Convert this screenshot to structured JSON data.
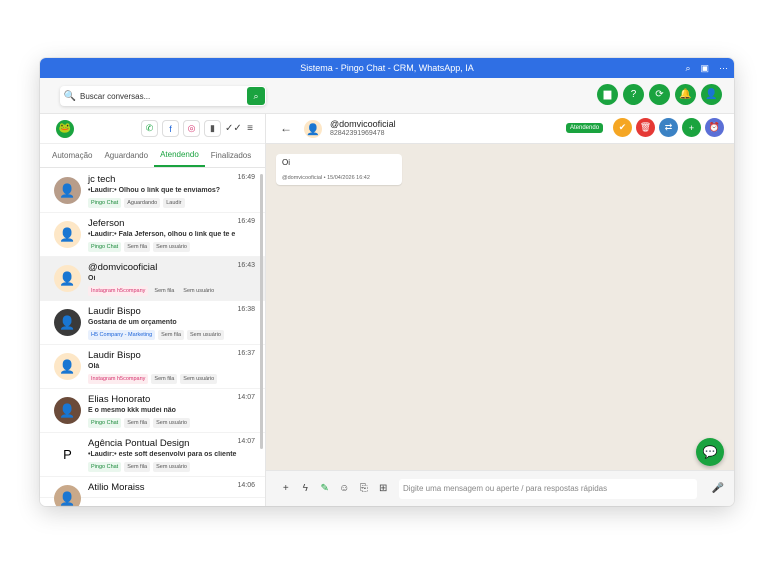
{
  "window": {
    "title": "Sistema - Pingo Chat - CRM, WhatsApp, IA"
  },
  "titlebar_icons": [
    "zoom-icon",
    "cast-icon",
    "more-icon"
  ],
  "search": {
    "placeholder": "Buscar conversas..."
  },
  "top_actions": [
    {
      "name": "chat-icon",
      "glyph": "▆"
    },
    {
      "name": "help-icon",
      "glyph": "?"
    },
    {
      "name": "refresh-icon",
      "glyph": "⟳"
    },
    {
      "name": "bell-icon",
      "glyph": "🔔"
    },
    {
      "name": "user-icon",
      "glyph": "👤"
    }
  ],
  "tabs": [
    {
      "label": "Automação",
      "active": false
    },
    {
      "label": "Aguardando",
      "active": false
    },
    {
      "label": "Atendendo",
      "active": true
    },
    {
      "label": "Finalizados",
      "active": false
    }
  ],
  "conversations": [
    {
      "name": "jc tech",
      "time": "16:49",
      "message": "•Laudir:• Olhou o link que te enviamos?",
      "tags": [
        {
          "text": "Pingo Chat",
          "kind": "wa"
        },
        {
          "text": "Aguardando",
          "kind": ""
        },
        {
          "text": "Laudir",
          "kind": ""
        }
      ],
      "avatar_bg": "#b89d8a",
      "avatar_glyph": "👤"
    },
    {
      "name": "Jeferson",
      "time": "16:49",
      "message": "•Laudir:• Fala Jeferson, olhou o link que te e",
      "tags": [
        {
          "text": "Pingo Chat",
          "kind": "wa"
        },
        {
          "text": "Sem fila",
          "kind": ""
        },
        {
          "text": "Sem usuário",
          "kind": ""
        }
      ],
      "avatar_bg": "#fde7c7",
      "avatar_glyph": "👤"
    },
    {
      "name": "@domvicooficial",
      "time": "16:43",
      "message": "Oi",
      "tags": [
        {
          "text": "Instagram h5company",
          "kind": "ig"
        },
        {
          "text": "Sem fila",
          "kind": ""
        },
        {
          "text": "Sem usuário",
          "kind": ""
        }
      ],
      "avatar_bg": "#fde7c7",
      "avatar_glyph": "👤",
      "selected": true
    },
    {
      "name": "Laudir Bispo",
      "time": "16:38",
      "message": "Gostaria de um orçamento",
      "tags": [
        {
          "text": "H5 Company - Marketing",
          "kind": "fb"
        },
        {
          "text": "Sem fila",
          "kind": ""
        },
        {
          "text": "Sem usuário",
          "kind": ""
        }
      ],
      "avatar_bg": "#3a3a3a",
      "avatar_glyph": "👤"
    },
    {
      "name": "Laudir Bispo",
      "time": "16:37",
      "message": "Olá",
      "tags": [
        {
          "text": "Instagram h5company",
          "kind": "ig"
        },
        {
          "text": "Sem fila",
          "kind": ""
        },
        {
          "text": "Sem usuário",
          "kind": ""
        }
      ],
      "avatar_bg": "#fde7c7",
      "avatar_glyph": "👤"
    },
    {
      "name": "Elias Honorato",
      "time": "14:07",
      "message": "E o mesmo kkk mudei não",
      "tags": [
        {
          "text": "Pingo Chat",
          "kind": "wa"
        },
        {
          "text": "Sem fila",
          "kind": ""
        },
        {
          "text": "Sem usuário",
          "kind": ""
        }
      ],
      "avatar_bg": "#6b4b3a",
      "avatar_glyph": "👤"
    },
    {
      "name": "Agência Pontual Design",
      "time": "14:07",
      "message": "•Laudir:• este soft desenvolvi para os cliente",
      "tags": [
        {
          "text": "Pingo Chat",
          "kind": "wa"
        },
        {
          "text": "Sem fila",
          "kind": ""
        },
        {
          "text": "Sem usuário",
          "kind": ""
        }
      ],
      "avatar_bg": "#ffffff",
      "avatar_glyph": "P"
    },
    {
      "name": "Atilio Moraiss",
      "time": "14:06",
      "message": "",
      "tags": [],
      "avatar_bg": "#c9a98a",
      "avatar_glyph": "👤"
    }
  ],
  "chat": {
    "name": "@domvicooficial",
    "phone": "82842391969478",
    "status": "Atendendo",
    "message": {
      "text": "Oi",
      "meta": "@domvicooficial • 15/04/2026 16:42"
    }
  },
  "head_actions": [
    {
      "name": "accept-icon",
      "glyph": "✔",
      "color": "#f5a623"
    },
    {
      "name": "delete-icon",
      "glyph": "🗑",
      "color": "#e53935"
    },
    {
      "name": "transfer-icon",
      "glyph": "⇄",
      "color": "#3b82c4"
    },
    {
      "name": "add-icon",
      "glyph": "+",
      "color": "#1aa33f"
    },
    {
      "name": "schedule-icon",
      "glyph": "⏰",
      "color": "#5b6fd6"
    }
  ],
  "composer": {
    "placeholder": "Digite uma mensagem ou aperte / para respostas rápidas"
  },
  "colors": {
    "accent": "#1aa33f",
    "titlebar": "#2f6fe4"
  }
}
